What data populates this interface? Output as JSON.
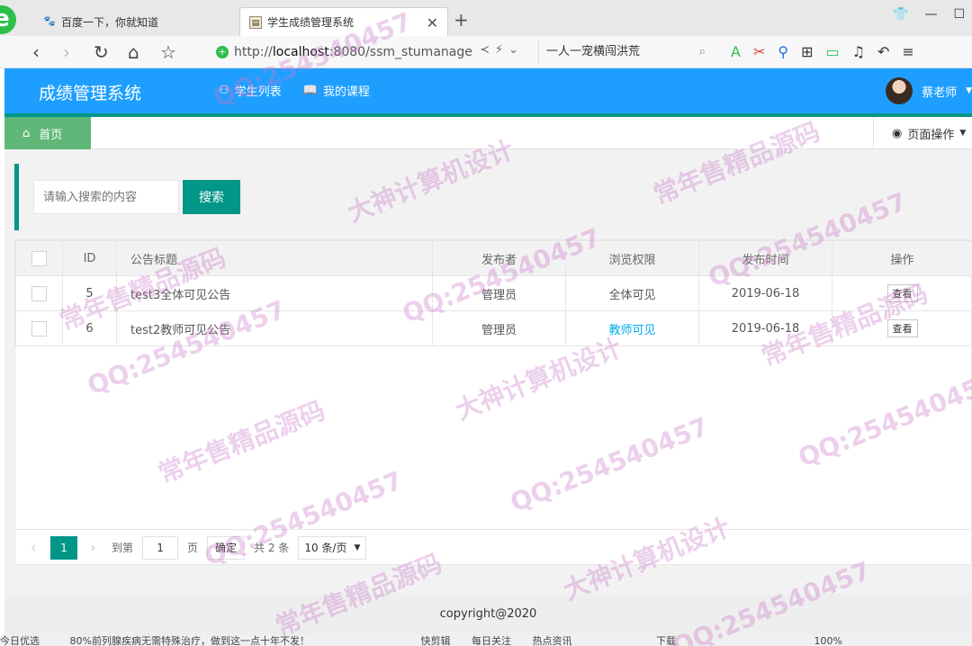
{
  "browser": {
    "tabs": [
      {
        "title": "百度一下，你就知道",
        "favicon": "baidu-paw-icon"
      },
      {
        "title": "学生成绩管理系统",
        "favicon": "page-icon"
      }
    ],
    "url_prefix": "http://",
    "url_host": "localhost",
    "url_rest": ":8080/ssm_stumanage",
    "search_text": "一人一宠横闯洪荒"
  },
  "app": {
    "title": "成绩管理系统",
    "nav": [
      {
        "label": "学生列表",
        "icon": "users-icon"
      },
      {
        "label": "我的课程",
        "icon": "book-icon"
      }
    ],
    "user_name": "蔡老师"
  },
  "tabs": {
    "home_label": "首页",
    "page_ops_label": "页面操作"
  },
  "search": {
    "placeholder": "请输入搜索的内容",
    "button_label": "搜索"
  },
  "table": {
    "headers": [
      "ID",
      "公告标题",
      "发布者",
      "浏览权限",
      "发布时间",
      "操作"
    ],
    "rows": [
      {
        "id": "5",
        "title": "test3全体可见公告",
        "publisher": "管理员",
        "permission": "全体可见",
        "date": "2019-06-18",
        "action": "查看"
      },
      {
        "id": "6",
        "title": "test2教师可见公告",
        "publisher": "管理员",
        "permission": "教师可见",
        "date": "2019-06-18",
        "action": "查看"
      }
    ]
  },
  "pager": {
    "current": "1",
    "goto_label": "到第",
    "page_input": "1",
    "page_word": "页",
    "confirm_label": "确定",
    "total": "共 2 条",
    "limit": "10 条/页"
  },
  "footer": {
    "copyright": "copyright@2020"
  },
  "statusbar": {
    "items": [
      "今日优选",
      "80%前列腺疾病无需特殊治疗，做到这一点十年不发！",
      "快剪辑",
      "每日关注",
      "热点资讯",
      "下载",
      "100%"
    ]
  },
  "watermarks": [
    "QQ:254540457",
    "常年售精品源码",
    "大神计算机设计"
  ],
  "colors": {
    "header_blue": "#1e9fff",
    "teal": "#009688",
    "home_green": "#5fb878",
    "link_blue": "#01aaed"
  }
}
